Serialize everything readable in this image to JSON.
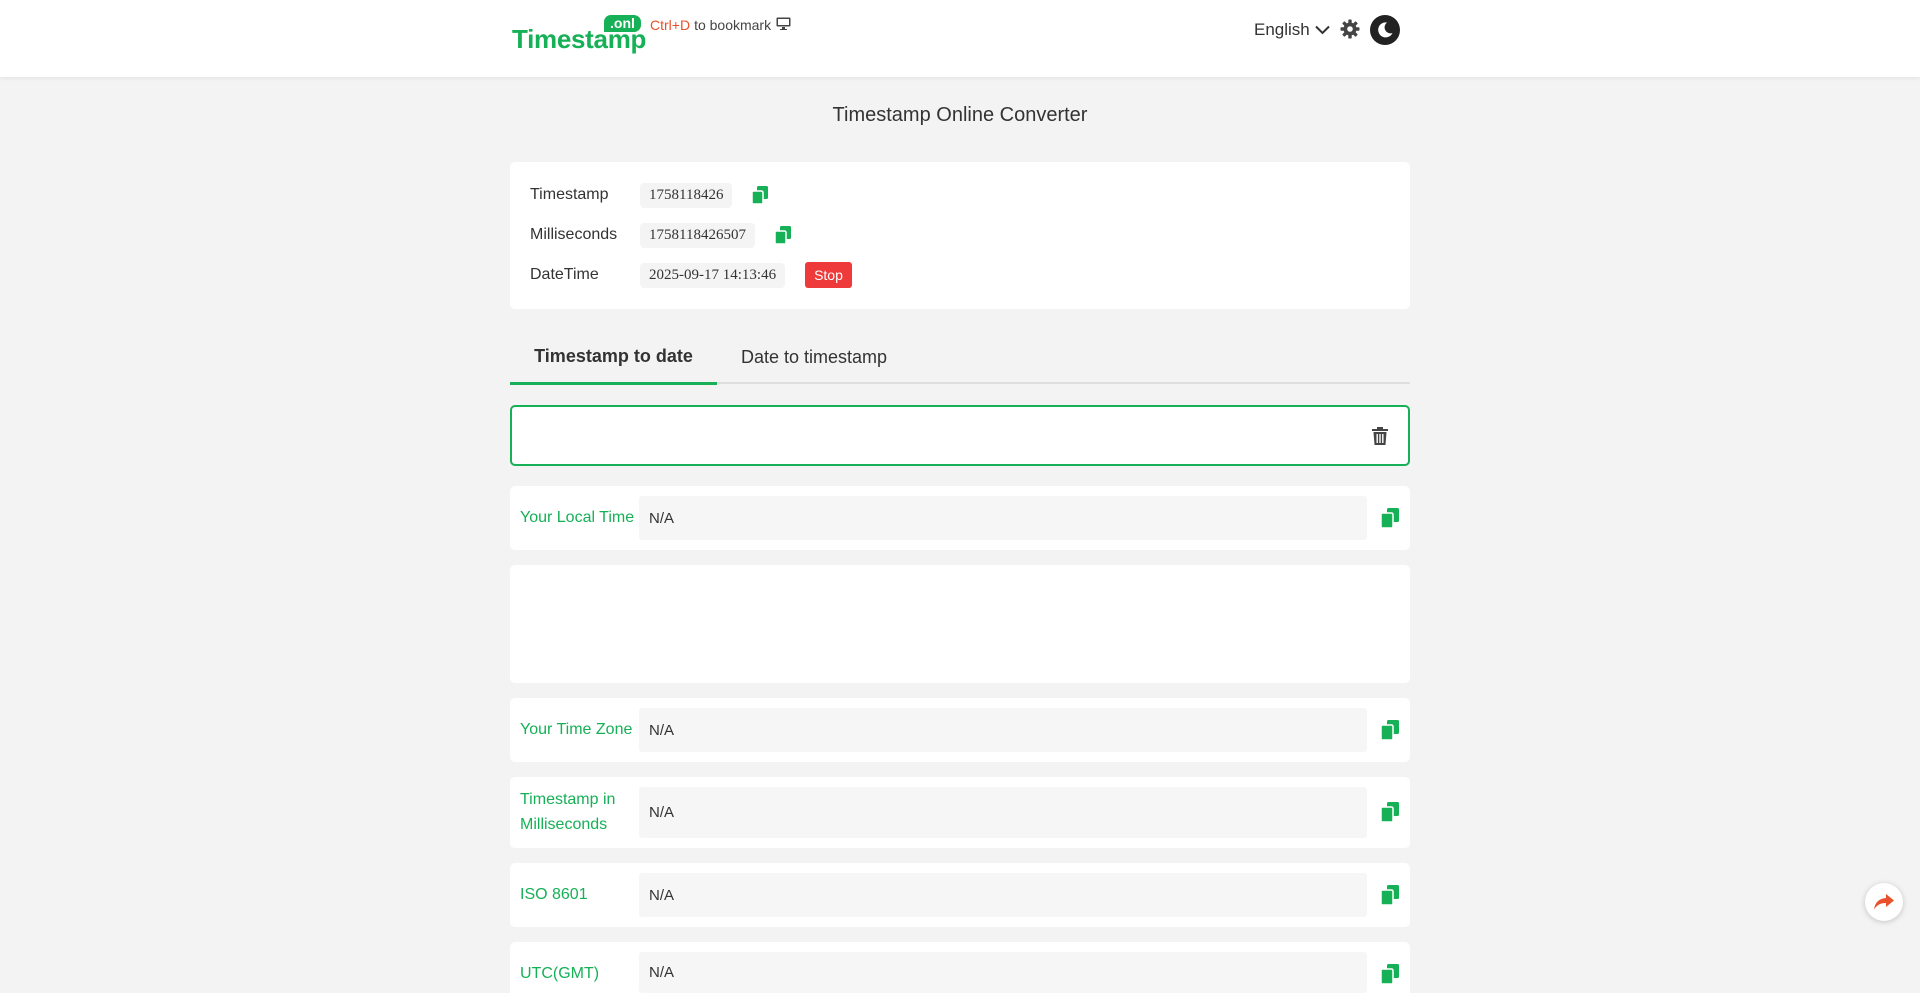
{
  "header": {
    "logo_text": "Timestamp",
    "logo_badge": ".onl",
    "bookmark_keys": "Ctrl+D",
    "bookmark_text": "to bookmark",
    "language": "English"
  },
  "page_title": "Timestamp Online Converter",
  "current": {
    "timestamp_label": "Timestamp",
    "timestamp_value": "1758118426",
    "milliseconds_label": "Milliseconds",
    "milliseconds_value": "1758118426507",
    "datetime_label": "DateTime",
    "datetime_value": "2025-09-17 14:13:46",
    "stop_label": "Stop"
  },
  "tabs": [
    {
      "label": "Timestamp to date",
      "active": true
    },
    {
      "label": "Date to timestamp",
      "active": false
    }
  ],
  "input": {
    "value": "",
    "placeholder": ""
  },
  "results": {
    "local_time": {
      "label": "Your Local Time",
      "value": "N/A"
    },
    "time_zone": {
      "label": "Your Time Zone",
      "value": "N/A"
    },
    "ms_line1": "Timestamp in",
    "ms_line2": "Milliseconds",
    "ms_value": "N/A",
    "iso": {
      "label": "ISO 8601",
      "value": "N/A"
    },
    "utc": {
      "label": "UTC(GMT)",
      "value": "N/A"
    }
  },
  "colors": {
    "accent": "#16b057",
    "danger": "#ee3a3a",
    "bookmark_keys": "#e8512b",
    "share": "#e8512b"
  },
  "icons": [
    "copy-icon",
    "trash-icon",
    "gear-icon",
    "moon-icon",
    "chevron-down-icon",
    "monitor-icon",
    "share-icon"
  ]
}
